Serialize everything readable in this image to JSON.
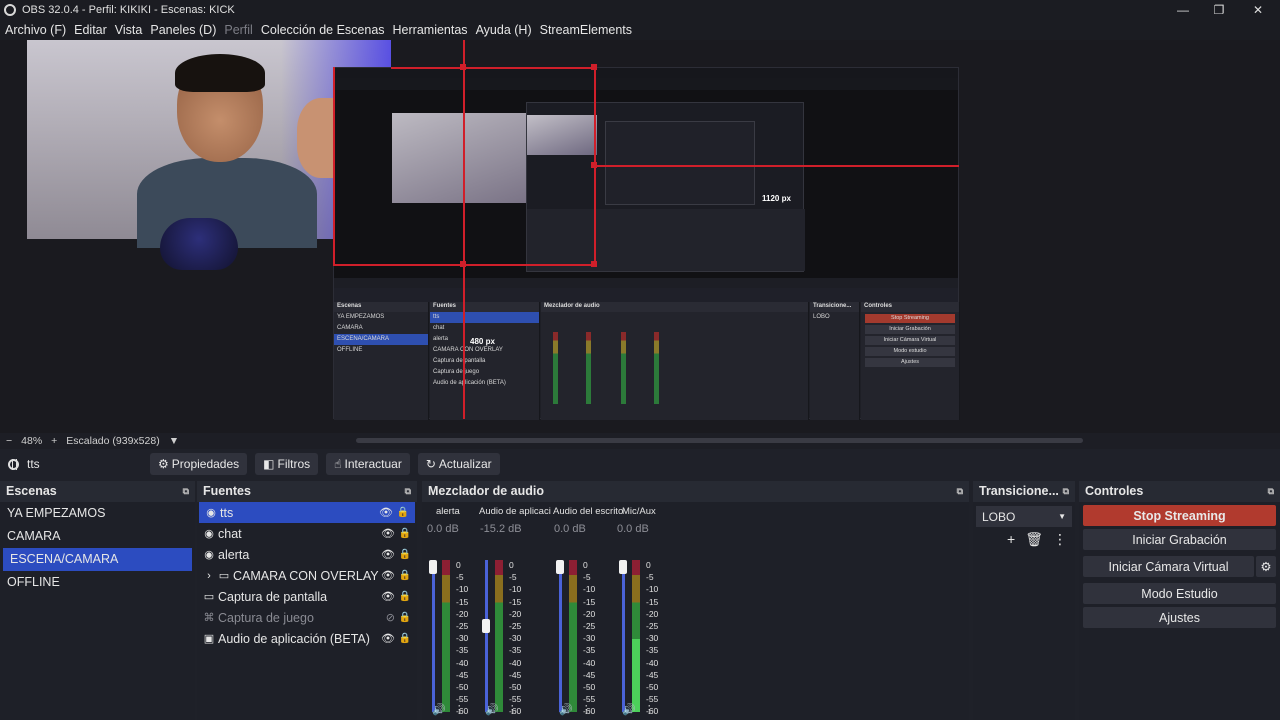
{
  "window": {
    "title": "OBS 32.0.4 - Perfil: KIKIKI - Escenas: KICK",
    "minimize_label": "—",
    "maximize_label": "❐",
    "close_label": "✕"
  },
  "menu": [
    {
      "label": "Archivo (F)",
      "enabled": true
    },
    {
      "label": "Editar",
      "enabled": true
    },
    {
      "label": "Vista",
      "enabled": true
    },
    {
      "label": "Paneles (D)",
      "enabled": true
    },
    {
      "label": "Perfil",
      "enabled": false
    },
    {
      "label": "Colección de Escenas",
      "enabled": true
    },
    {
      "label": "Herramientas",
      "enabled": true
    },
    {
      "label": "Ayuda (H)",
      "enabled": true
    },
    {
      "label": "StreamElements",
      "enabled": true
    }
  ],
  "preview": {
    "measure_width": "1120 px",
    "measure_height": "480 px",
    "nested": {
      "scenes_header": "Escenas",
      "sources_header": "Fuentes",
      "mixer_header": "Mezclador de audio",
      "transitions_header": "Transicione...",
      "controls_header": "Controles",
      "scenes": [
        "YA EMPEZAMOS",
        "CAMARA",
        "ESCENA/CAMARA",
        "OFFLINE"
      ],
      "sources": [
        "tts",
        "chat",
        "alerta",
        "CAMARA CON OVERLAY",
        "Captura de pantalla",
        "Captura de juego",
        "Audio de aplicación (BETA)"
      ],
      "transition": "LOBO",
      "buttons": [
        "Stop Streaming",
        "Iniciar Grabación",
        "Iniciar Cámara Virtual",
        "Modo estudio",
        "Ajustes"
      ]
    }
  },
  "zoombar": {
    "minus": "−",
    "zoom": "48%",
    "plus": "+",
    "scale_label": "Escalado (939x528)",
    "dropdown": "▼"
  },
  "source_toolbar": {
    "selected_source": "tts",
    "properties": "Propiedades",
    "filters": "Filtros",
    "interact": "Interactuar",
    "refresh": "Actualizar"
  },
  "scenes": {
    "header": "Escenas",
    "items": [
      {
        "label": "YA EMPEZAMOS"
      },
      {
        "label": "CAMARA"
      },
      {
        "label": "ESCENA/CAMARA"
      },
      {
        "label": "OFFLINE"
      }
    ],
    "selected_index": 2
  },
  "sources": {
    "header": "Fuentes",
    "items": [
      {
        "label": "tts",
        "icon": "globe-icon"
      },
      {
        "label": "chat",
        "icon": "globe-icon"
      },
      {
        "label": "alerta",
        "icon": "globe-icon"
      },
      {
        "label": "CAMARA CON OVERLAY",
        "icon": "folder-icon"
      },
      {
        "label": "Captura de pantalla",
        "icon": "monitor-icon"
      },
      {
        "label": "Captura de juego",
        "icon": "gamepad-icon"
      },
      {
        "label": "Audio de aplicación (BETA)",
        "icon": "audio-app-icon"
      }
    ]
  },
  "mixer": {
    "header": "Mezclador de audio",
    "scale": [
      "0",
      "-5",
      "-10",
      "-15",
      "-20",
      "-25",
      "-30",
      "-35",
      "-40",
      "-45",
      "-50",
      "-55",
      "-60"
    ],
    "channels": [
      {
        "name": "alerta",
        "db": "0.0 dB",
        "fader_level": 1.0
      },
      {
        "name": "Audio de aplicaci",
        "db": "-15.2 dB",
        "fader_level": 0.58
      },
      {
        "name": "Audio del escrito",
        "db": "0.0 dB",
        "fader_level": 1.0
      },
      {
        "name": "Mic/Aux",
        "db": "0.0 dB",
        "fader_level": 1.0
      }
    ]
  },
  "transitions": {
    "header": "Transicione...",
    "selected": "LOBO"
  },
  "controls": {
    "header": "Controles",
    "stop_streaming": "Stop Streaming",
    "start_recording": "Iniciar Grabación",
    "start_virtual_cam": "Iniciar Cámara Virtual",
    "studio_mode": "Modo Estudio",
    "settings": "Ajustes"
  },
  "colors": {
    "accent": "#2c4cc0",
    "stop": "#b13a2e",
    "measure_lines": "#d01f2a"
  }
}
